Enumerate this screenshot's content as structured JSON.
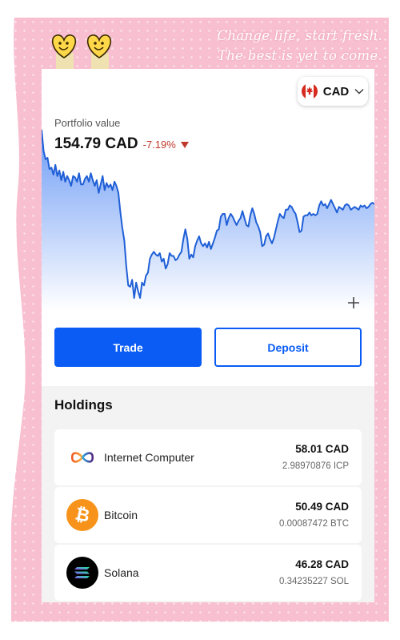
{
  "background": {
    "quote_line1": "Change life, start fresh.",
    "quote_line2": "The best is yet to come."
  },
  "currency": {
    "code": "CAD",
    "icon": "canada-flag-icon"
  },
  "portfolio": {
    "label": "Portfolio value",
    "value": "154.79 CAD",
    "change": "-7.19%",
    "change_color": "#c0392b"
  },
  "chart_data": {
    "type": "area",
    "title": "",
    "xlabel": "",
    "ylabel": "",
    "y": [
      186,
      171,
      165,
      166,
      158,
      159,
      154,
      161,
      153,
      157,
      150,
      156,
      149,
      153,
      150,
      146,
      153,
      152,
      149,
      155,
      147,
      147,
      151,
      153,
      149,
      155,
      150,
      146,
      150,
      141,
      147,
      153,
      143,
      148,
      145,
      147,
      143,
      149,
      146,
      141,
      127,
      116,
      107,
      89,
      75,
      74,
      79,
      66,
      77,
      71,
      66,
      77,
      75,
      82,
      84,
      94,
      97,
      99,
      97,
      96,
      98,
      92,
      94,
      87,
      90,
      98,
      96,
      96,
      93,
      94,
      97,
      99,
      108,
      115,
      108,
      94,
      97,
      95,
      103,
      107,
      110,
      105,
      103,
      105,
      102,
      106,
      101,
      105,
      109,
      114,
      115,
      124,
      126,
      126,
      118,
      123,
      126,
      124,
      121,
      118,
      121,
      123,
      128,
      123,
      118,
      117,
      125,
      130,
      126,
      120,
      117,
      113,
      103,
      104,
      110,
      112,
      108,
      105,
      109,
      115,
      121,
      126,
      124,
      123,
      129,
      129,
      132,
      131,
      128,
      126,
      120,
      113,
      114,
      124,
      125,
      125,
      127,
      125,
      126,
      125,
      126,
      132,
      135,
      132,
      133,
      130,
      133,
      136,
      133,
      130,
      127,
      131,
      130,
      129,
      132,
      133,
      132,
      129,
      130,
      131,
      130,
      129,
      132,
      131,
      132,
      130,
      131,
      133,
      134,
      133
    ],
    "line_color": "#1f5fd6",
    "fill_top": "#6e9cf5",
    "fill_bottom": "#ffffff"
  },
  "actions": {
    "trade": "Trade",
    "deposit": "Deposit",
    "add_icon": "plus-icon"
  },
  "holdings": {
    "title": "Holdings",
    "items": [
      {
        "name": "Internet Computer",
        "value": "58.01 CAD",
        "amount": "2.98970876 ICP",
        "icon": "internet-computer-icon"
      },
      {
        "name": "Bitcoin",
        "value": "50.49 CAD",
        "amount": "0.00087472 BTC",
        "icon": "bitcoin-icon"
      },
      {
        "name": "Solana",
        "value": "46.28 CAD",
        "amount": "0.34235227 SOL",
        "icon": "solana-icon"
      }
    ]
  }
}
